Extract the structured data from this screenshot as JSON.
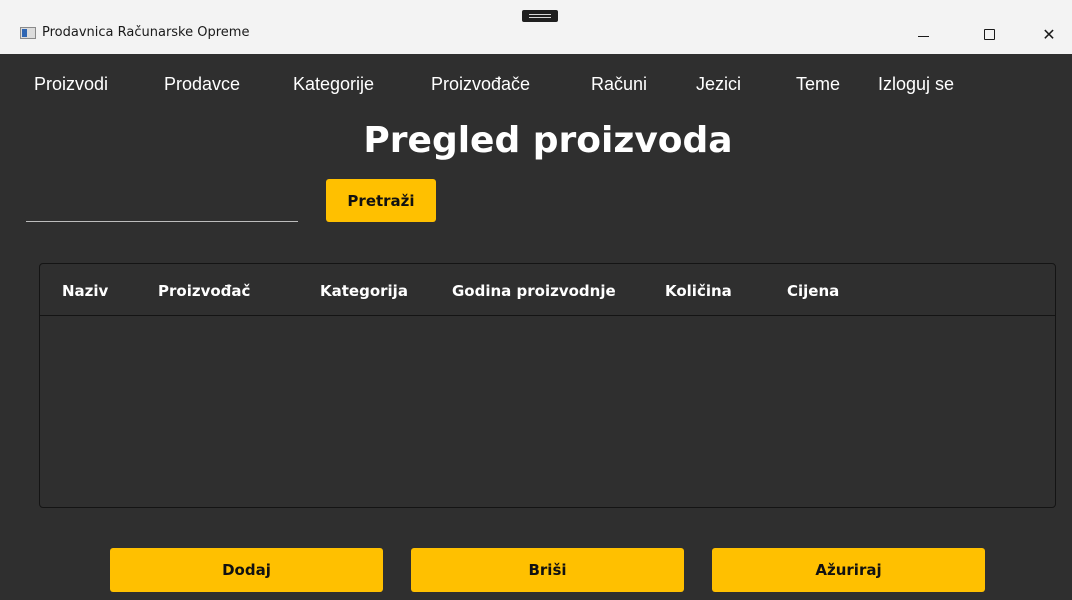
{
  "window": {
    "title": "Prodavnica Računarske Opreme",
    "controls": [
      "minimize",
      "maximize",
      "close"
    ]
  },
  "menu": {
    "items": [
      "Proizvodi",
      "Prodavce",
      "Kategorije",
      "Proizvođače",
      "Računi",
      "Jezici",
      "Teme",
      "Izloguj se"
    ]
  },
  "page": {
    "title": "Pregled proizvoda"
  },
  "search": {
    "value": "",
    "placeholder": "",
    "button_label": "Pretraži"
  },
  "table": {
    "columns": [
      "Naziv",
      "Proizvođač",
      "Kategorija",
      "Godina proizvodnje",
      "Količina",
      "Cijena"
    ],
    "rows": []
  },
  "actions": {
    "add_label": "Dodaj",
    "delete_label": "Briši",
    "update_label": "Ažuriraj"
  },
  "colors": {
    "background": "#2f2f2f",
    "accent": "#ffc000",
    "titlebar": "#f3f3f3"
  }
}
